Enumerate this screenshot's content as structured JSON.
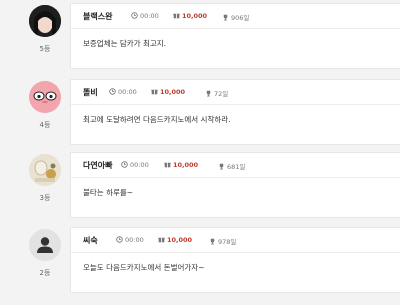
{
  "entries": [
    {
      "rank": "5등",
      "name": "블랙스완",
      "time": "00:00",
      "points": "10,000",
      "days": "906일",
      "message": "보증업체는 담카가 최고지."
    },
    {
      "rank": "4등",
      "name": "똘비",
      "time": "00:00",
      "points": "10,000",
      "days": "72일",
      "message": "최고에 도달하려면 다음드카지노에서 시작하라."
    },
    {
      "rank": "3등",
      "name": "다연아빠",
      "time": "00:00",
      "points": "10,000",
      "days": "681일",
      "message": "불타는 하루를~"
    },
    {
      "rank": "2등",
      "name": "씨숙",
      "time": "00:00",
      "points": "10,000",
      "days": "978일",
      "message": "오늘도 다음드카지노에서 돈벌어가자~"
    }
  ],
  "colors": {
    "points": "#c0392b",
    "background": "#f3f3f3",
    "card": "#ffffff"
  }
}
